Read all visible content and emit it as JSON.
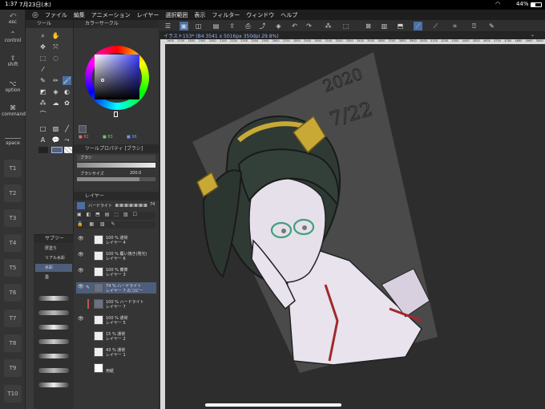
{
  "status": {
    "time": "1:37",
    "date": "7月23日(木)",
    "battery": "44%"
  },
  "menu": [
    "ファイル",
    "編集",
    "アニメーション",
    "レイヤー",
    "選択範囲",
    "表示",
    "フィルター",
    "ウィンドウ",
    "ヘルプ"
  ],
  "edge_buttons": {
    "esc": "esc",
    "control": "control",
    "shift": "shift",
    "option": "option",
    "command": "command",
    "space": "space"
  },
  "t_buttons": [
    "T1",
    "T2",
    "T3",
    "T4",
    "T5",
    "T6",
    "T7",
    "T8",
    "T9",
    "T10"
  ],
  "panels": {
    "tool": "ツール",
    "color": "カラーサークル",
    "property": "ツールプロパティ [ブラシ]",
    "layer": "レイヤー",
    "subtool": "サブツー"
  },
  "color": {
    "r": "82",
    "g": "83",
    "b": "96"
  },
  "property": {
    "brush_name": "ブラシ",
    "brush_size_label": "ブラシサイズ",
    "brush_size": "200.0"
  },
  "layer_controls": {
    "blend": "ハードライト",
    "opacity": "74"
  },
  "layers": [
    {
      "l1": "100 % 通常",
      "l2": "レイヤー 4"
    },
    {
      "l1": "100 % 覆い焼き(発光)",
      "l2": "レイヤー 6"
    },
    {
      "l1": "100 % 乗算",
      "l2": "レイヤー 3"
    },
    {
      "l1": "74 % ハードライト",
      "l2": "レイヤー 7 のコピー"
    },
    {
      "l1": "100 % ハードライト",
      "l2": "レイヤー 7"
    },
    {
      "l1": "100 % 通常",
      "l2": "レイヤー 5"
    },
    {
      "l1": "15 % 通常",
      "l2": "レイヤー 2"
    },
    {
      "l1": "43 % 通常",
      "l2": "レイヤー 1"
    },
    {
      "l1": "",
      "l2": "用紙"
    }
  ],
  "subtools": [
    "厚塗り",
    "リアル水彩",
    "水彩",
    "墨"
  ],
  "doc_tab": "イラスト153* (B4 3541 x 5016px 350dpi 29.8%)",
  "ruler_ticks": [
    "1600",
    "1700",
    "1800",
    "1900",
    "2000",
    "2100",
    "2200",
    "2300",
    "2400",
    "2500",
    "2600",
    "2700",
    "2800",
    "2900",
    "3000",
    "3100",
    "3200",
    "3300",
    "3400",
    "3500",
    "3600",
    "3700",
    "3800",
    "3900",
    "4000",
    "4100",
    "4200",
    "4300",
    "4400",
    "4500",
    "4600",
    "4700",
    "4780",
    "4880",
    "4960",
    "5060"
  ],
  "canvas_text": {
    "year": "2020",
    "date": "7/22"
  },
  "colors": {
    "accent": "#4a6fa5",
    "hair": "#2f3a35",
    "bow": "#c9a935",
    "skin": "#ece6ef",
    "glasses": "#3fa07a",
    "red": "#a02a2a"
  }
}
